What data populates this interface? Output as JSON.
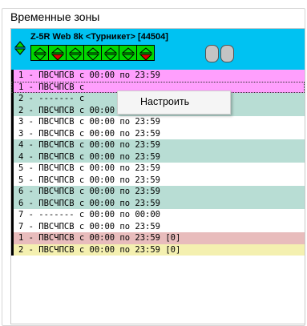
{
  "group": {
    "title": "Временные зоны"
  },
  "device": {
    "title": "Z-5R Web 8k <Турникет> [44504]",
    "indicators": [
      {
        "arrow": "down",
        "red": false
      },
      {
        "arrow": "down",
        "red": true
      },
      {
        "arrow": "down",
        "red": false
      },
      {
        "arrow": "down",
        "red": false
      },
      {
        "arrow": "down",
        "red": false
      },
      {
        "arrow": "down",
        "red": false
      },
      {
        "arrow": "down",
        "red": true
      }
    ]
  },
  "rows": [
    {
      "text": "1 - ПВСЧПСВ с 00:00 по 23:59",
      "color": "c0"
    },
    {
      "text": "1 - ПВСЧПСВ с",
      "color": "c0",
      "selected": true
    },
    {
      "text": "2 - ------- с",
      "color": "c1"
    },
    {
      "text": "2 - ПВСЧПСВ с 00:00 по 23:59",
      "color": "c1"
    },
    {
      "text": "3 - ПВСЧПСВ с 00:00 по 23:59",
      "color": "c2"
    },
    {
      "text": "3 - ПВСЧПСВ с 00:00 по 23:59",
      "color": "c2"
    },
    {
      "text": "4 - ПВСЧПСВ с 00:00 по 23:59",
      "color": "c1"
    },
    {
      "text": "4 - ПВСЧПСВ с 00:00 по 23:59",
      "color": "c1"
    },
    {
      "text": "5 - ПВСЧПСВ с 00:00 по 23:59",
      "color": "c2"
    },
    {
      "text": "5 - ПВСЧПСВ с 00:00 по 23:59",
      "color": "c2"
    },
    {
      "text": "6 - ПВСЧПСВ с 00:00 по 23:59",
      "color": "c1"
    },
    {
      "text": "6 - ПВСЧПСВ с 00:00 по 23:59",
      "color": "c1"
    },
    {
      "text": "7 - ------- с 00:00 по 00:00",
      "color": "c2"
    },
    {
      "text": "7 - ПВСЧПСВ с 00:00 по 23:59",
      "color": "c2"
    },
    {
      "text": "1 - ПВСЧПСВ с 00:00 по 23:59 [0]",
      "color": "c3"
    },
    {
      "text": "2 - ПВСЧПСВ с 00:00 по 23:59 [0]",
      "color": "c4"
    }
  ],
  "context_menu": {
    "items": [
      "Настроить"
    ]
  },
  "colors": {
    "header": "#00c2f2",
    "indicator_green": "#00d800",
    "indicator_red": "#e00000"
  }
}
